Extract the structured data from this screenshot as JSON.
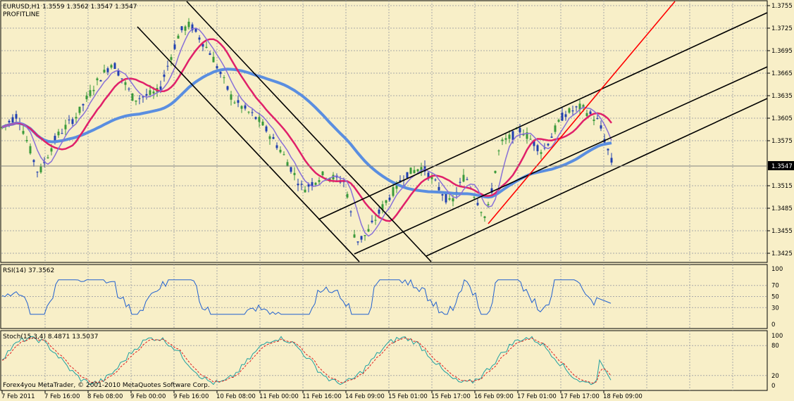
{
  "chart_data": [
    {
      "type": "candlestick",
      "title": "EURUSD,H1  1.3559 1.3562 1.3547 1.3547",
      "indicator_label": "PROFITLINE",
      "current_price_label": "1.3547",
      "current_price": 1.3547,
      "ylim": [
        1.341,
        1.376
      ],
      "yticks": [
        "1.3755",
        "1.3725",
        "1.3695",
        "1.3665",
        "1.3635",
        "1.3605",
        "1.3575",
        "1.3515",
        "1.3485",
        "1.3455",
        "1.3425"
      ],
      "grid": true,
      "grid_style": "dotted",
      "colors": {
        "bull": "#3a9a3a",
        "bear": "#1f3fb0",
        "ma_fast": "#8870d8",
        "ma_mid": "#e0206a",
        "ma_slow": "#5a8ee0",
        "trendline": "#ff0000",
        "channel": "#000000"
      }
    },
    {
      "type": "line",
      "title": "RSI(14) 37.3562",
      "ylim": [
        0,
        100
      ],
      "yticks": [
        "100",
        "70",
        "50",
        "30",
        "0"
      ],
      "last_value": 37.3562,
      "color": "#2060d0"
    },
    {
      "type": "line",
      "title": "Stoch(15,3,4) 8.4871 13.5037",
      "ylim": [
        0,
        100
      ],
      "yticks": [
        "100",
        "80",
        "20",
        "0"
      ],
      "series": [
        {
          "name": "main",
          "last_value": 8.4871,
          "color": "#20a0a0"
        },
        {
          "name": "signal",
          "last_value": 13.5037,
          "color": "#e02020"
        }
      ]
    }
  ],
  "xaxis": {
    "ticks": [
      "7 Feb 2011",
      "7 Feb 16:00",
      "8 Feb 08:00",
      "9 Feb 00:00",
      "9 Feb 16:00",
      "10 Feb 08:00",
      "11 Feb 00:00",
      "11 Feb 16:00",
      "14 Feb 09:00",
      "15 Feb 01:00",
      "15 Feb 17:00",
      "16 Feb 09:00",
      "17 Feb 01:00",
      "17 Feb 17:00",
      "18 Feb 09:00"
    ]
  },
  "copyright": "Forex4you MetaTrader, © 2001-2010 MetaQuotes Software Corp."
}
